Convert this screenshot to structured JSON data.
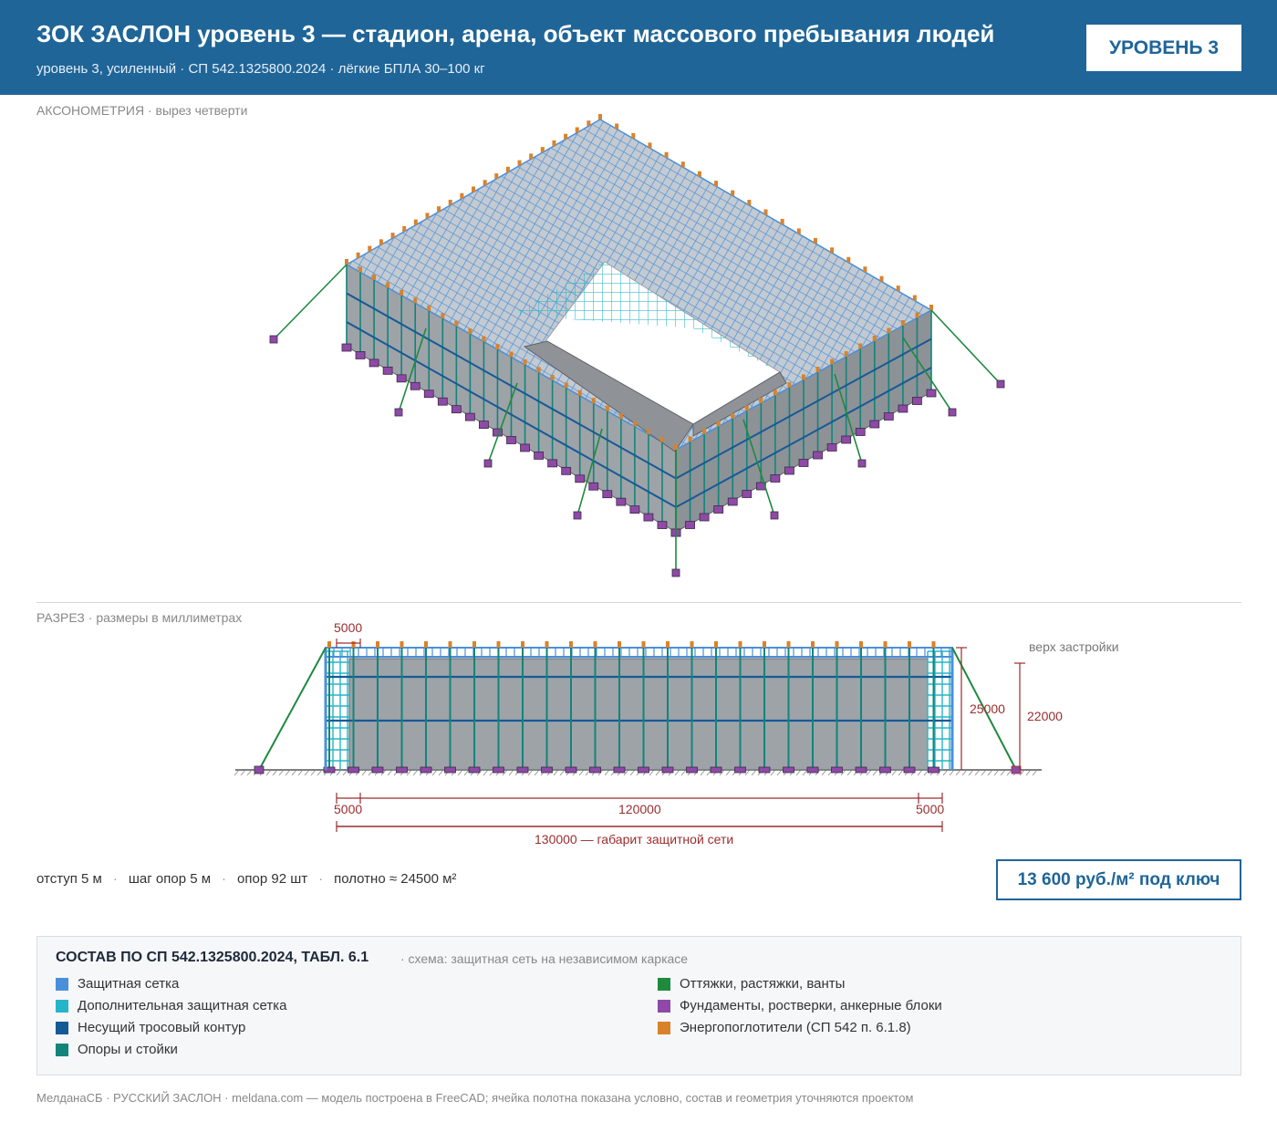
{
  "header": {
    "title": "ЗОК ЗАСЛОН уровень 3 — стадион, арена, объект массового пребывания людей",
    "subtitle": "уровень 3, усиленный · СП 542.1325800.2024 · лёгкие БПЛА 30–100 кг",
    "badge": "УРОВЕНЬ 3"
  },
  "axon": {
    "label": "АКСОНОМЕТРИЯ",
    "label_note": "· вырез четверти"
  },
  "section": {
    "label": "РАЗРЕЗ",
    "label_note": "· размеры в миллиметрах",
    "dim_top_step": "5000",
    "dim_height_net": "25000",
    "dim_height_building": "22000",
    "building_note": "верх застройки",
    "dim_left": "5000",
    "dim_middle": "120000",
    "dim_right": "5000",
    "dim_total": "130000 — габарит защитной сети"
  },
  "stats": {
    "offset": "отступ 5 м",
    "step": "шаг опор 5 м",
    "supports": "опор 92 шт",
    "area": "полотно ≈ 24500 м²",
    "separator": "·"
  },
  "price": "13 600 руб./м² под ключ",
  "legend": {
    "title": "СОСТАВ ПО СП 542.1325800.2024, ТАБЛ. 6.1",
    "scheme": "· схема: защитная сеть на независимом каркасе",
    "items": [
      {
        "label": "Защитная сетка",
        "color": "#4a90d9"
      },
      {
        "label": "Дополнительная защитная сетка",
        "color": "#26b5c8"
      },
      {
        "label": "Несущий тросовый контур",
        "color": "#155a96"
      },
      {
        "label": "Опоры и стойки",
        "color": "#12857a"
      },
      {
        "label": "Оттяжки, растяжки, ванты",
        "color": "#1e8a3e"
      },
      {
        "label": "Фундаменты, ростверки, анкерные блоки",
        "color": "#8e4aa6"
      },
      {
        "label": "Энергопоглотители (СП 542 п. 6.1.8)",
        "color": "#d9822b"
      }
    ]
  },
  "footer": "МелданаСБ · РУССКИЙ ЗАСЛОН · meldana.com — модель построена в FreeCAD; ячейка полотна показана условно, состав и геометрия уточняются проектом"
}
